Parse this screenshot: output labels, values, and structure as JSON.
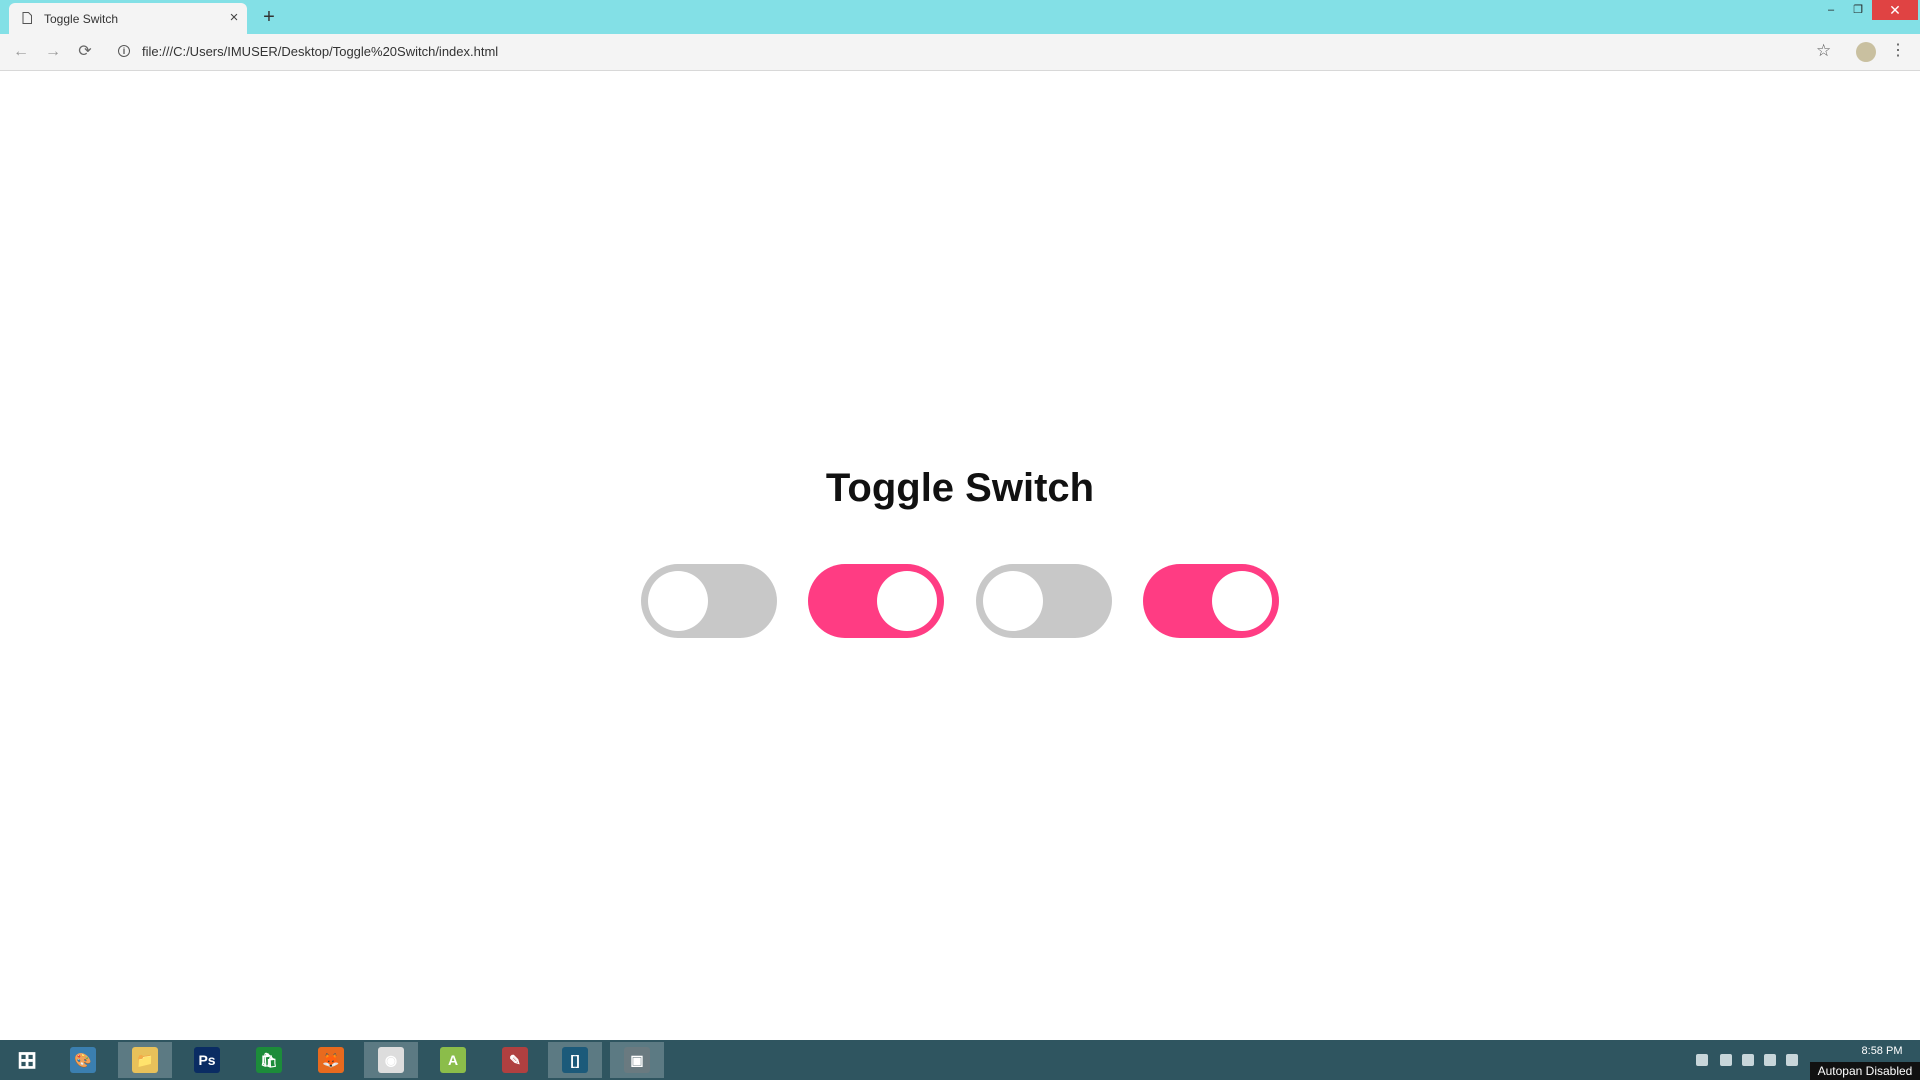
{
  "browser": {
    "tab_title": "Toggle Switch",
    "tab_close": "×",
    "new_tab": "+",
    "url": "file:///C:/Users/IMUSER/Desktop/Toggle%20Switch/index.html",
    "window_controls": {
      "minimize": "–",
      "maximize": "❐",
      "close": "✕"
    },
    "nav": {
      "back": "←",
      "forward": "→",
      "reload": "⟳"
    },
    "star": "☆",
    "menu": "⋮"
  },
  "page": {
    "heading": "Toggle Switch",
    "toggles": [
      {
        "state": "off"
      },
      {
        "state": "on"
      },
      {
        "state": "off"
      },
      {
        "state": "on"
      }
    ],
    "colors": {
      "on": "#ff3c83",
      "off": "#c8c8c8",
      "knob": "#ffffff"
    }
  },
  "taskbar": {
    "items": [
      {
        "icon": "windows-start-icon",
        "glyph": "⊞"
      },
      {
        "icon": "paint-icon",
        "glyph": "🎨"
      },
      {
        "icon": "file-explorer-icon",
        "glyph": "📁"
      },
      {
        "icon": "photoshop-icon",
        "glyph": "Ps"
      },
      {
        "icon": "store-icon",
        "glyph": "🛍"
      },
      {
        "icon": "firefox-icon",
        "glyph": "🦊"
      },
      {
        "icon": "chrome-icon",
        "glyph": "◉"
      },
      {
        "icon": "android-studio-icon",
        "glyph": "A"
      },
      {
        "icon": "paint-tool-icon",
        "glyph": "✎"
      },
      {
        "icon": "brackets-icon",
        "glyph": "[]"
      },
      {
        "icon": "screen-recorder-icon",
        "glyph": "▣"
      }
    ],
    "clock": "8:58 PM",
    "autopan": "Autopan Disabled"
  }
}
